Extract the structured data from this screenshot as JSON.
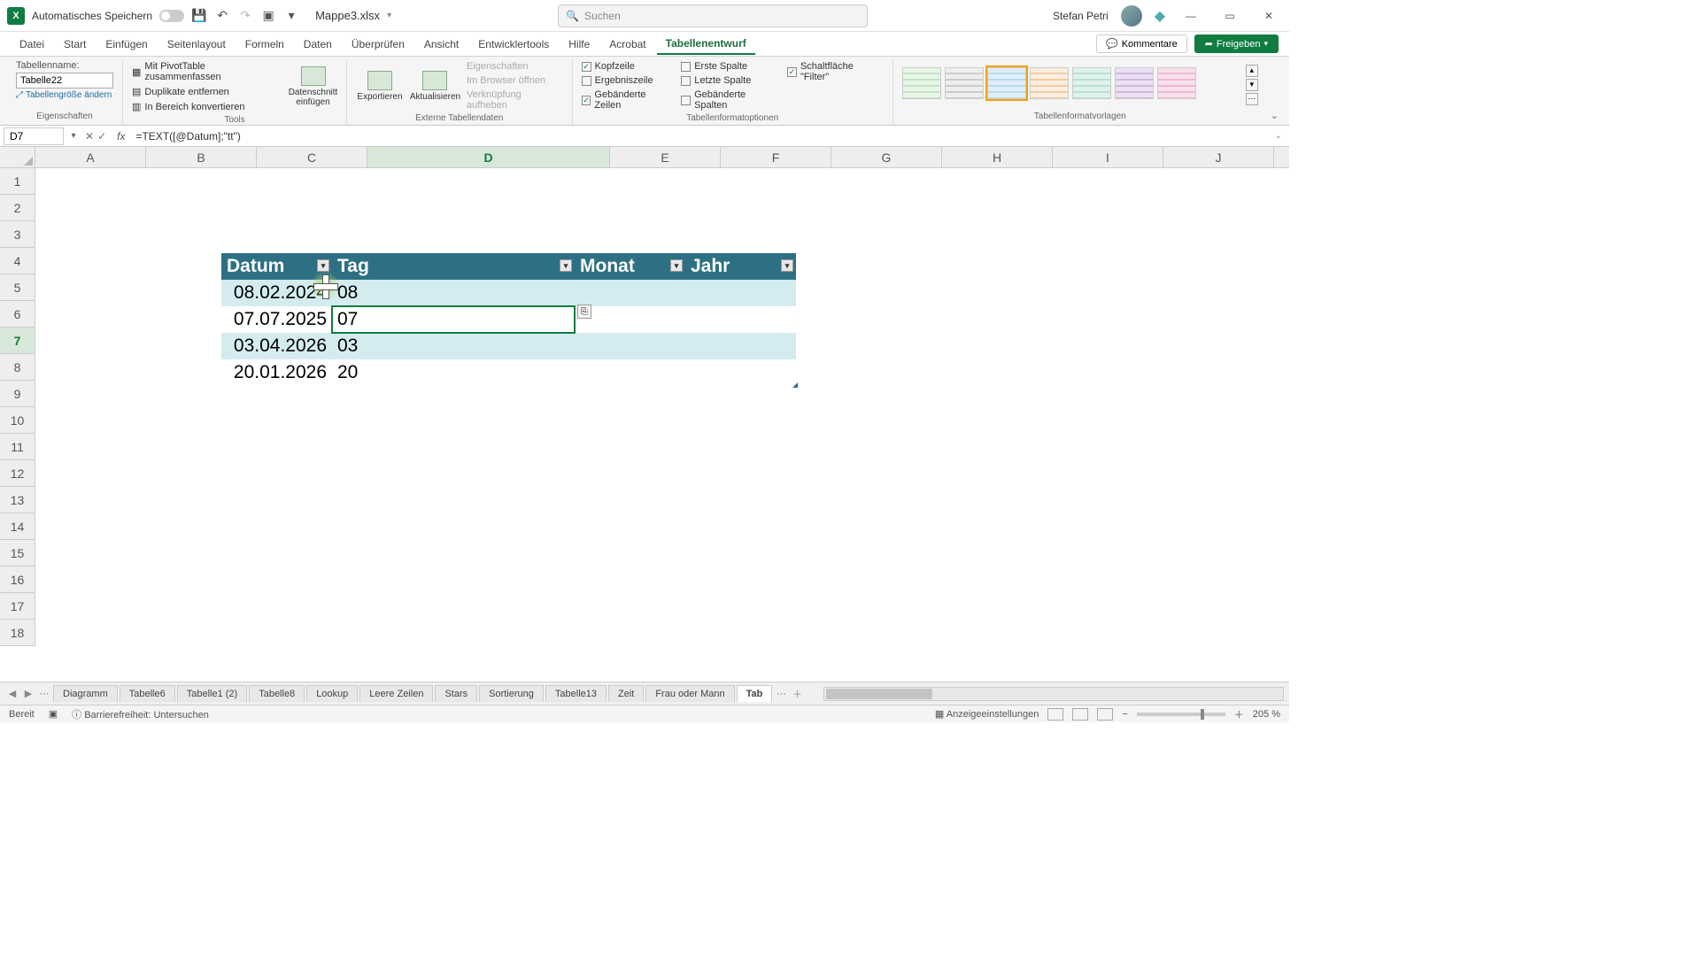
{
  "title": {
    "autosave": "Automatisches Speichern",
    "doc": "Mappe3.xlsx",
    "search_placeholder": "Suchen",
    "user": "Stefan Petri"
  },
  "tabs": {
    "items": [
      "Datei",
      "Start",
      "Einfügen",
      "Seitenlayout",
      "Formeln",
      "Daten",
      "Überprüfen",
      "Ansicht",
      "Entwicklertools",
      "Hilfe",
      "Acrobat",
      "Tabellenentwurf"
    ],
    "active": "Tabellenentwurf",
    "comments": "Kommentare",
    "share": "Freigeben"
  },
  "ribbon": {
    "props": {
      "name_label": "Tabellenname:",
      "name_value": "Tabelle22",
      "resize": "Tabellengröße ändern",
      "group": "Eigenschaften"
    },
    "tools": {
      "pivot": "Mit PivotTable zusammenfassen",
      "dup": "Duplikate entfernen",
      "range": "In Bereich konvertieren",
      "slicer": "Datenschnitt einfügen",
      "group": "Tools"
    },
    "ext": {
      "export": "Exportieren",
      "refresh": "Aktualisieren",
      "p1": "Eigenschaften",
      "p2": "Im Browser öffnen",
      "p3": "Verknüpfung aufheben",
      "group": "Externe Tabellendaten"
    },
    "styleopts": {
      "header": "Kopfzeile",
      "total": "Ergebniszeile",
      "banded_r": "Gebänderte Zeilen",
      "first": "Erste Spalte",
      "last": "Letzte Spalte",
      "banded_c": "Gebänderte Spalten",
      "filter": "Schaltfläche \"Filter\"",
      "group": "Tabellenformatoptionen"
    },
    "styles_group": "Tabellenformatvorlagen"
  },
  "namebox": "D7",
  "formula": "=TEXT([@Datum];\"tt\")",
  "columns": [
    "A",
    "B",
    "C",
    "D",
    "E",
    "F",
    "G",
    "H",
    "I",
    "J"
  ],
  "rows": [
    "1",
    "2",
    "3",
    "4",
    "5",
    "6",
    "7",
    "8",
    "9",
    "10",
    "11",
    "12",
    "13",
    "14",
    "15",
    "16",
    "17",
    "18"
  ],
  "table": {
    "headers": {
      "c": "Datum",
      "d": "Tag",
      "e": "Monat",
      "f": "Jahr"
    },
    "rows": [
      {
        "c": "08.02.2024",
        "d": "08",
        "e": "",
        "f": ""
      },
      {
        "c": "07.07.2025",
        "d": "07",
        "e": "",
        "f": ""
      },
      {
        "c": "03.04.2026",
        "d": "03",
        "e": "",
        "f": ""
      },
      {
        "c": "20.01.2026",
        "d": "20",
        "e": "",
        "f": ""
      }
    ]
  },
  "sheets": {
    "items": [
      "Diagramm",
      "Tabelle6",
      "Tabelle1 (2)",
      "Tabelle8",
      "Lookup",
      "Leere Zeilen",
      "Stars",
      "Sortierung",
      "Tabelle13",
      "Zeit",
      "Frau oder Mann",
      "Tab"
    ],
    "active": "Tab"
  },
  "status": {
    "ready": "Bereit",
    "acc": "Barrierefreiheit: Untersuchen",
    "display": "Anzeigeeinstellungen",
    "zoom": "205 %"
  }
}
